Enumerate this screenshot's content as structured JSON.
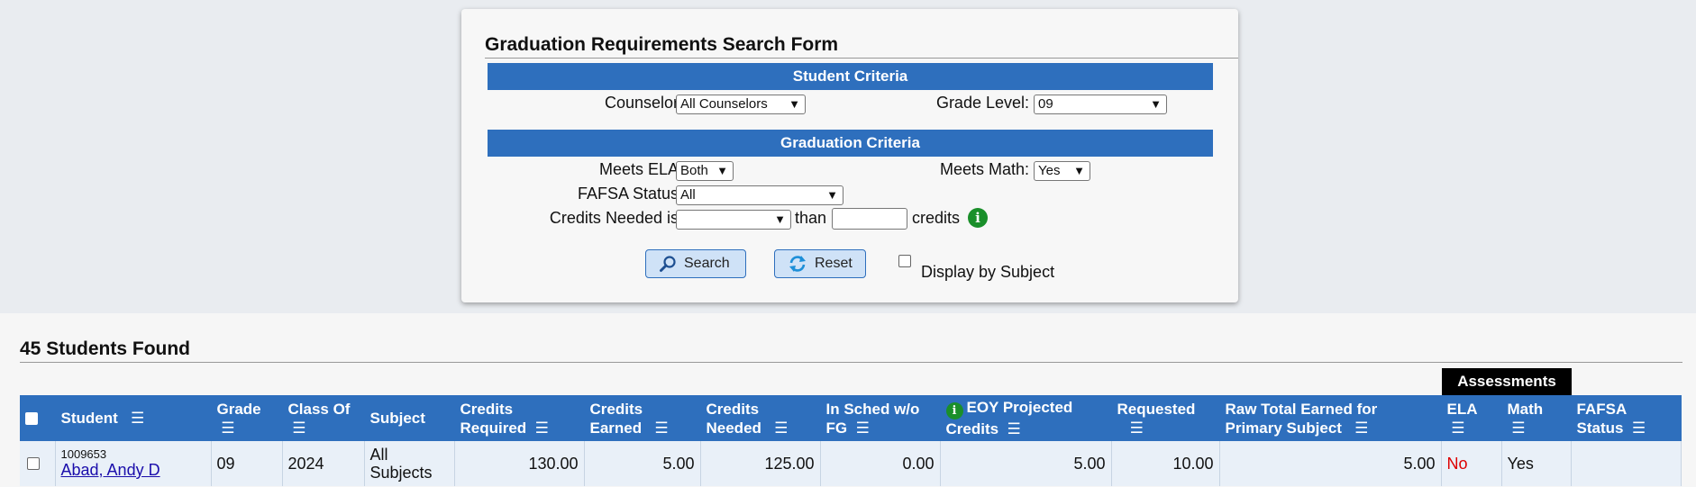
{
  "form": {
    "title": "Graduation Requirements Search Form",
    "student_criteria": "Student Criteria",
    "counselor_label": "Counselor:",
    "counselor_value": "All Counselors",
    "grade_level_label": "Grade Level:",
    "grade_level_value": "09",
    "graduation_criteria": "Graduation Criteria",
    "meets_ela_label": "Meets ELA:",
    "meets_ela_value": "Both",
    "meets_math_label": "Meets Math:",
    "meets_math_value": "Yes",
    "fafsa_label": "FAFSA Status:",
    "fafsa_value": "All",
    "credits_needed_label": "Credits Needed is:",
    "credits_needed_value": "",
    "than_label": "than",
    "credits_label": "credits",
    "search_label": "Search",
    "reset_label": "Reset",
    "display_by_subject_label": "Display by Subject"
  },
  "results": {
    "title": "45 Students Found",
    "assessments_label": "Assessments",
    "columns": [
      "Student",
      "Grade",
      "Class Of",
      "Subject",
      "Credits Required",
      "Credits Earned",
      "Credits Needed",
      "In Sched w/o FG",
      "EOY Projected Credits",
      "Requested",
      "Raw Total Earned for Primary Subject",
      "ELA",
      "Math",
      "FAFSA Status"
    ],
    "menu_glyph": "☰",
    "rows": [
      {
        "id": "1009653",
        "name": "Abad, Andy D",
        "grade": "09",
        "class_of": "2024",
        "subject": "All Subjects",
        "credits_required": "130.00",
        "credits_earned": "5.00",
        "credits_needed": "125.00",
        "in_sched": "0.00",
        "eoy_projected": "5.00",
        "requested": "10.00",
        "raw_total": "5.00",
        "ela": "No",
        "math": "Yes",
        "fafsa": ""
      }
    ]
  },
  "colors": {
    "header_blue": "#2e6fbd",
    "ela_no": "#dd0000",
    "info_green": "#1a8f2a"
  }
}
